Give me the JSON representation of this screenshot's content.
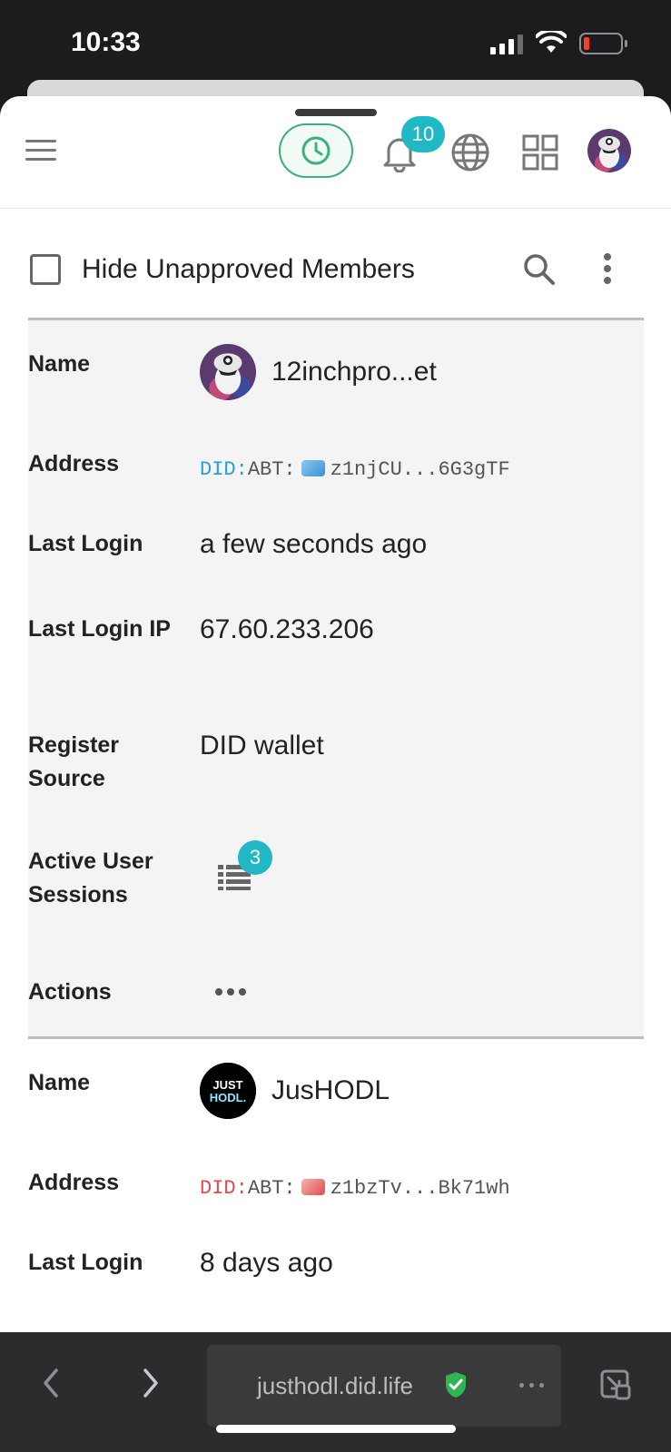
{
  "status": {
    "time": "10:33"
  },
  "header": {
    "notifications_count": "10"
  },
  "toolbar": {
    "hide_unapproved_label": "Hide Unapproved Members",
    "hide_unapproved_checked": false
  },
  "labels": {
    "name": "Name",
    "address": "Address",
    "last_login": "Last Login",
    "last_login_ip": "Last Login IP",
    "register_source": "Register Source",
    "active_sessions": "Active User Sessions",
    "actions": "Actions"
  },
  "members": [
    {
      "name": "12inchpro...et",
      "did_prefix": "DID:",
      "did_chain": "ABT:",
      "address": "z1njCU...6G3gTF",
      "last_login": "a few seconds ago",
      "last_login_ip": "67.60.233.206",
      "register_source": "DID wallet",
      "active_sessions": "3",
      "did_color": "#2a9fd6"
    },
    {
      "name": "JusHODL",
      "avatar_text": "JUST HODL.",
      "did_prefix": "DID:",
      "did_chain": "ABT:",
      "address": "z1bzTv...Bk71wh",
      "last_login": "8 days ago",
      "did_color": "#e04b4b"
    }
  ],
  "browser": {
    "url": "justhodl.did.life"
  },
  "colors": {
    "accent_teal": "#1fb8c4",
    "accent_green": "#3ab07a"
  },
  "icons": [
    "menu-icon",
    "clock-icon",
    "bell-icon",
    "globe-icon",
    "apps-icon",
    "search-icon",
    "more-vert-icon",
    "list-icon",
    "more-horiz-icon",
    "chevron-left-icon",
    "chevron-right-icon",
    "shield-check-icon",
    "shrink-window-icon"
  ]
}
